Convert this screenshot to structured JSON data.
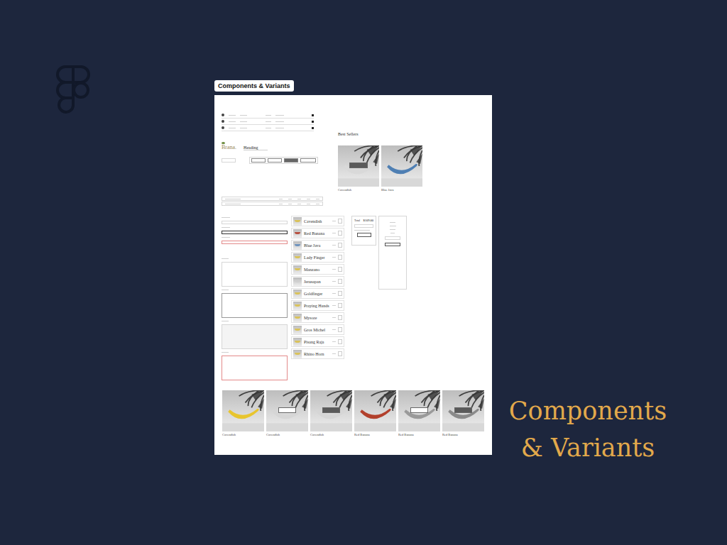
{
  "tab": "Components & Variants",
  "headline": [
    "Components",
    "& Variants"
  ],
  "logo": "Brana.",
  "heading_sample": "Heading",
  "best_sellers": {
    "title": "Best Sellers",
    "cards": [
      {
        "name": "Cavendish",
        "color": "#d9d9d9",
        "kind": "hover-dark"
      },
      {
        "name": "Blue Java",
        "color": "#4f7fb3",
        "kind": "default"
      }
    ]
  },
  "product_list": [
    {
      "name": "Cavendish",
      "color": "#d9c25a"
    },
    {
      "name": "Red Banana",
      "color": "#b7503f"
    },
    {
      "name": "Blue Java",
      "color": "#6f93bd"
    },
    {
      "name": "Lady Finger",
      "color": "#d9c25a"
    },
    {
      "name": "Manzano",
      "color": "#d9c25a"
    },
    {
      "name": "Jerusapan",
      "color": "#cfcfcf"
    },
    {
      "name": "Goldfinger",
      "color": "#d9c25a"
    },
    {
      "name": "Praying Hands",
      "color": "#d9c25a"
    },
    {
      "name": "Mysore",
      "color": "#d9c25a"
    },
    {
      "name": "Gros Michel",
      "color": "#d9c25a"
    },
    {
      "name": "Pisang Raja",
      "color": "#d9c25a"
    },
    {
      "name": "Rhino Horn",
      "color": "#d9c25a"
    }
  ],
  "total": {
    "label": "Total",
    "amount": "$109.00"
  },
  "variant_cards": [
    {
      "name": "Cavendish",
      "color": "#e8c52e",
      "kind": "default"
    },
    {
      "name": "Cavendish",
      "color": "#d6d6d6",
      "kind": "hover-light"
    },
    {
      "name": "Cavendish",
      "color": "#d6d6d6",
      "kind": "hover-dark"
    },
    {
      "name": "Red Banana",
      "color": "#b2402c",
      "kind": "default"
    },
    {
      "name": "Red Banana",
      "color": "#9a9a9a",
      "kind": "hover-light"
    },
    {
      "name": "Red Banana",
      "color": "#8a8a8a",
      "kind": "hover-dark"
    }
  ]
}
